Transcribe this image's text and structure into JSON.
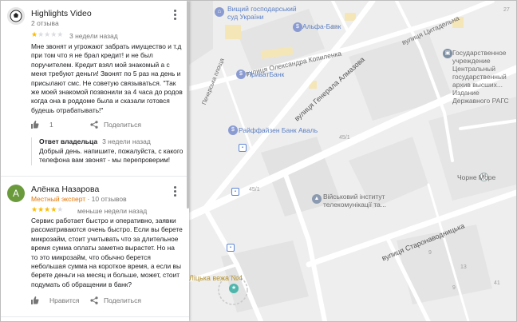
{
  "map": {
    "labels": {
      "court": "Вищий господарський\nсуд України",
      "alfa": "Альфа-Банк",
      "citadel": "вулиця Цитадельна",
      "koneva": "вулиця Олександра Копиленка",
      "archive": "Государственное\nучреждение\nЦентральный\nгосударственный\nархив высших...\nИздание Державного РАГС",
      "pechersk": "Печерська площа",
      "privat": "ПриватБанк",
      "almazova": "вулиця Генерала Алмазова",
      "raiffeisen": "Райффайзен Банк Аваль",
      "chorne_more": "Чорне Море",
      "institute": "Військовий інститут\nтелекомунікації та...",
      "staronavodnytska": "вулиця Старонаводницька",
      "tower": "Ліцька вежа №4"
    },
    "house_numbers": [
      "45/1",
      "45/1",
      "13",
      "41",
      "9",
      "22",
      "27",
      "9"
    ]
  },
  "reviews": [
    {
      "name": "Highlights Video",
      "meta": "2 отзыва",
      "rating": 1,
      "when": "3 недели назад",
      "text": "Мне звонят и угрожают забрать имущество и т.д при том что я не брал кредит! и не был поручителем. Кредит взял мой знакомый а с меня требуют деньги! Звонят по 5 раз на день и присылают смс. Не советую связываться. \"Так же моей знакомой позвонили за 4 часа до родов когда она в роддоме была и сказали готовся будешь отрабатывать!\"",
      "likes": "1",
      "share": "Поделиться",
      "owner_reply": {
        "title": "Ответ владельца",
        "when": "3 недели назад",
        "text": "Добрый день. напишите, пожалуйста, с какого телефона вам звонят - мы перепроверим!"
      }
    },
    {
      "avatar_letter": "А",
      "name": "Алёнка Назарова",
      "expert": "Местный эксперт",
      "meta": " · 10 отзывов",
      "rating": 4,
      "when": "меньше недели назад",
      "text": "Сервис работает быстро и оперативно, заявки рассматриваются очень быстро. Если вы берете микрозайм, стоит учитывать что за длительное время сумма оплаты заметно вырастет. Но на то это микрозайм, что обычно берется небольшая сумма на короткое время, а если вы берете деньги на месяц и больше, может, стоит подумать об обращении в банк?",
      "like_label": "Нравится",
      "share": "Поделиться"
    }
  ]
}
